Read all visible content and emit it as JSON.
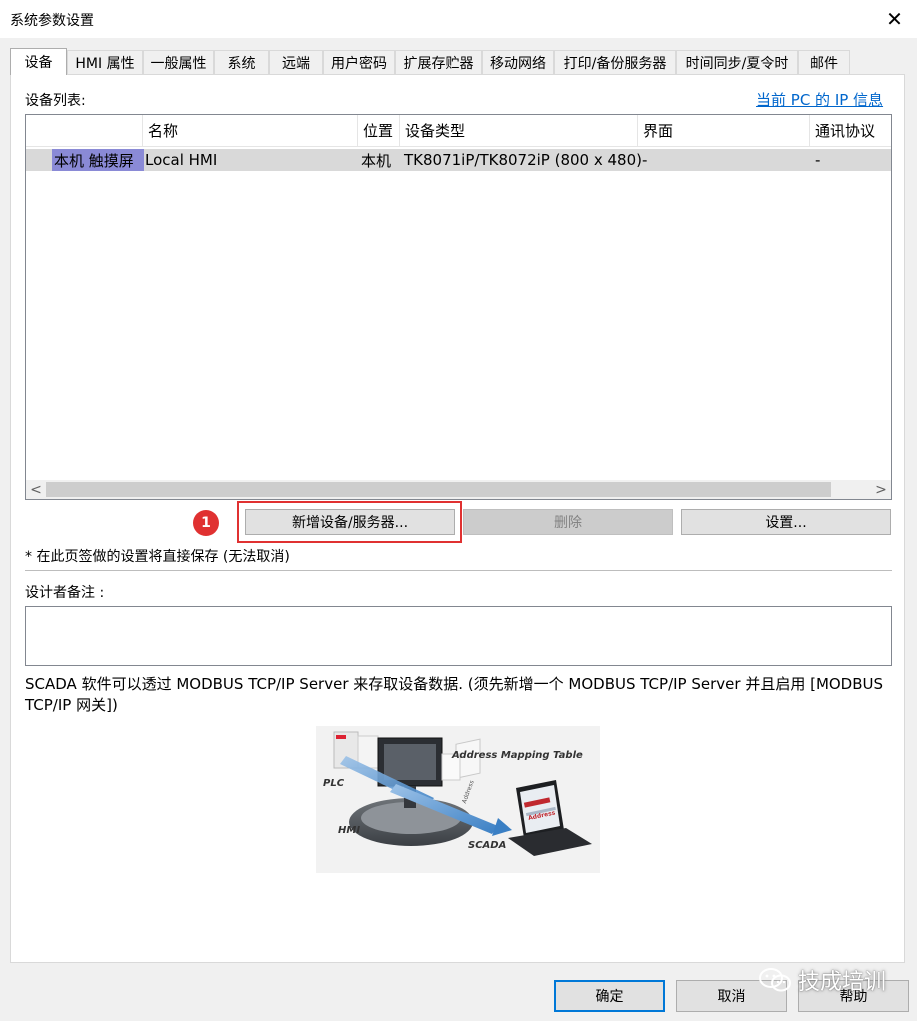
{
  "window": {
    "title": "系统参数设置",
    "close_glyph": "✕"
  },
  "tabs": [
    {
      "label": "设备",
      "active": true
    },
    {
      "label": "HMI 属性"
    },
    {
      "label": "一般属性"
    },
    {
      "label": "系统"
    },
    {
      "label": "远端"
    },
    {
      "label": "用户密码"
    },
    {
      "label": "扩展存贮器"
    },
    {
      "label": "移动网络"
    },
    {
      "label": "打印/备份服务器"
    },
    {
      "label": "时间同步/夏令时"
    },
    {
      "label": "邮件"
    }
  ],
  "device_list": {
    "label": "设备列表:",
    "pc_ip_link": "当前 PC 的 IP 信息",
    "columns": [
      "名称",
      "位置",
      "设备类型",
      "界面",
      "通讯协议"
    ],
    "rows": [
      {
        "row_header": "本机 触摸屏",
        "name": "Local HMI",
        "location": "本机",
        "device_type": "TK8071iP/TK8072iP (800 x 480)",
        "interface": "-",
        "protocol": "-"
      }
    ],
    "scroll_left": "<",
    "scroll_right": ">"
  },
  "buttons": {
    "add": "新增设备/服务器...",
    "delete": "删除",
    "settings": "设置...",
    "ok": "确定",
    "cancel": "取消",
    "help": "帮助"
  },
  "annotation": {
    "marker": "1",
    "color": "#e03131"
  },
  "note": "* 在此页签做的设置将直接保存 (无法取消)",
  "designer_notes_label": "设计者备注 :",
  "description": "SCADA 软件可以透过 MODBUS TCP/IP Server 来存取设备数据. (须先新增一个 MODBUS TCP/IP Server 并且启用 [MODBUS TCP/IP 网关])",
  "diagram": {
    "title": "Address Mapping Table",
    "plc": "PLC",
    "hmi": "HMI",
    "scada": "SCADA",
    "address": "Address",
    "screen_text": "Address"
  },
  "watermark": "技成培训",
  "colors": {
    "link": "#0066cc",
    "selection": "#8a8ad6",
    "accent": "#0078d7"
  }
}
